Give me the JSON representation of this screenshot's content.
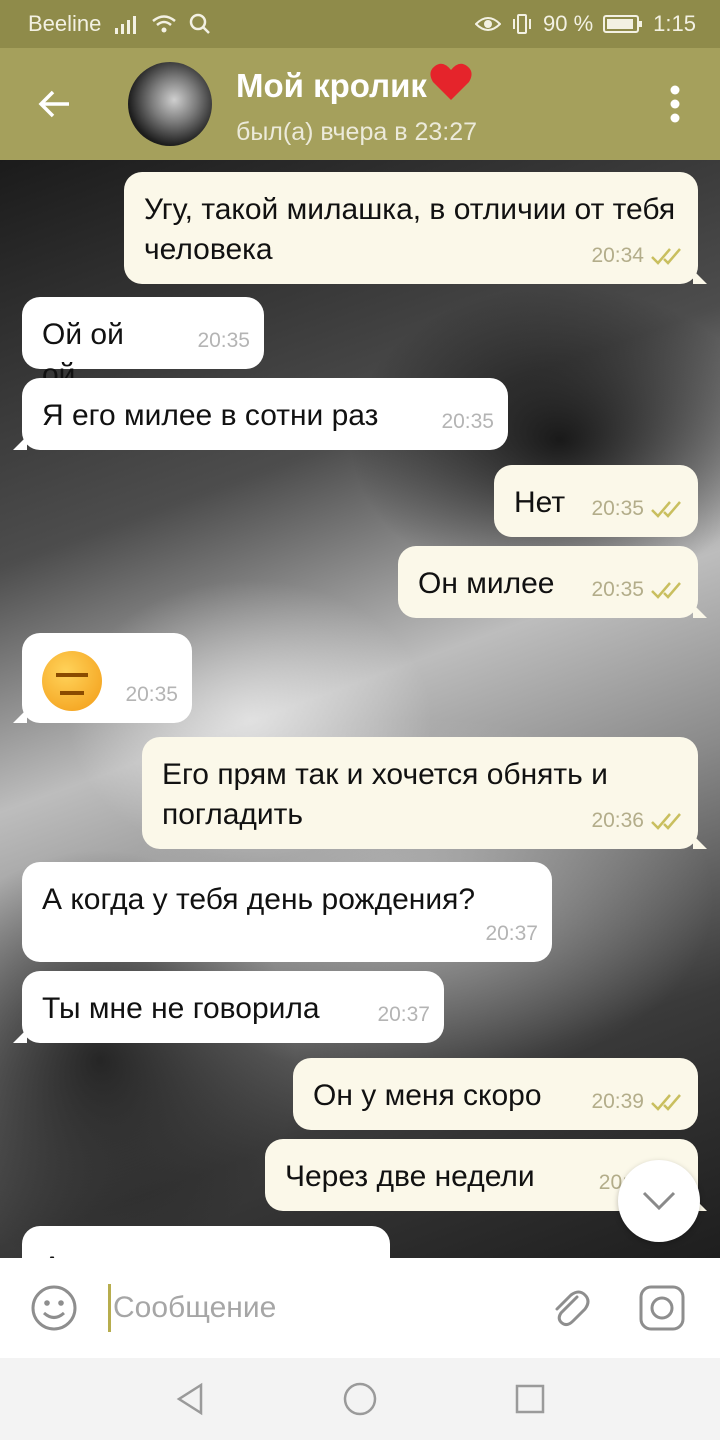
{
  "status_bar": {
    "carrier": "Beeline",
    "battery": "90 %",
    "time": "1:15"
  },
  "header": {
    "title": "Мой кролик",
    "title_heart": "❤️",
    "status": "был(а) вчера в 23:27"
  },
  "messages": [
    {
      "direction": "out",
      "text": "Угу, такой милашка, в отличии от тебя человека",
      "time": "20:34",
      "read": true
    },
    {
      "direction": "in",
      "text": "Ой ой ой",
      "time": "20:35"
    },
    {
      "direction": "in",
      "text": "Я его милее в сотни раз",
      "time": "20:35"
    },
    {
      "direction": "out",
      "text": "Нет",
      "time": "20:35",
      "read": true
    },
    {
      "direction": "out",
      "text": "Он милее",
      "time": "20:35",
      "read": true
    },
    {
      "direction": "in",
      "text": "😑",
      "time": "20:35",
      "emoji": "expressionless-face"
    },
    {
      "direction": "out",
      "text": "Его прям так и хочется обнять и погладить",
      "time": "20:36",
      "read": true
    },
    {
      "direction": "in",
      "text": "А когда у тебя день рождения?",
      "time": "20:37"
    },
    {
      "direction": "in",
      "text": "Ты мне не говорила",
      "time": "20:37"
    },
    {
      "direction": "out",
      "text": "Он у меня скоро",
      "time": "20:39",
      "read": true
    },
    {
      "direction": "out",
      "text": "Через две недели",
      "time": "20:",
      "read": true
    },
    {
      "direction": "in",
      "text": "А если потонее...",
      "time": ""
    }
  ],
  "input": {
    "placeholder": "Сообщение"
  },
  "colors": {
    "status_bar": "#8f8b4a",
    "header": "#a5a05c",
    "outgoing_bubble": "#fbf8e9",
    "incoming_bubble": "#ffffff",
    "read_check": "#c9bf5f"
  },
  "icons": {
    "back": "arrow-left-icon",
    "menu": "more-vertical-icon",
    "emoji": "smiley-icon",
    "attach": "paperclip-icon",
    "camera": "camera-icon",
    "scroll_down": "chevron-down-icon"
  }
}
